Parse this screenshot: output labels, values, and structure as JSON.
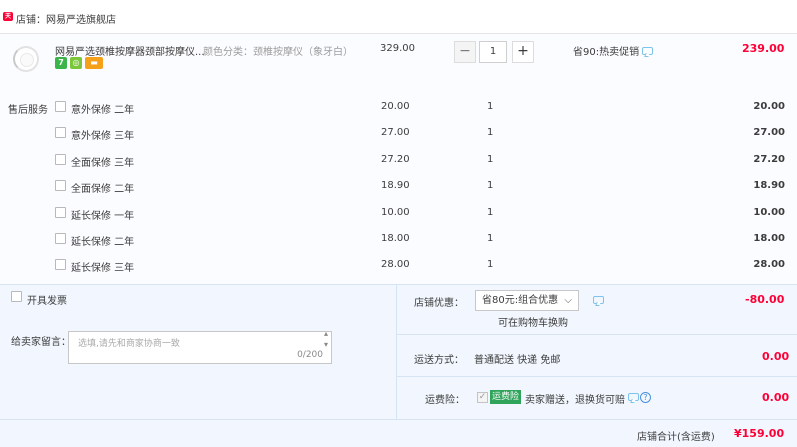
{
  "shop": {
    "badge": "天猫",
    "label": "店铺：网易严选旗舰店"
  },
  "item": {
    "title": "网易严选颈椎按摩器颈部按摩仪...",
    "sku": "颜色分类：颈椎按摩仪（象牙白）",
    "icons": [
      "seven-day-return-icon",
      "green-bag-icon",
      "card-icon"
    ],
    "price": "329.00",
    "quantity": "1",
    "minus": "−",
    "plus": "+",
    "promo": "省90:热卖促销",
    "subtotal": "239.00"
  },
  "services": {
    "label": "售后服务",
    "rows": [
      {
        "name": "意外保修 二年",
        "price": "20.00",
        "qty": "1",
        "sum": "20.00"
      },
      {
        "name": "意外保修 三年",
        "price": "27.00",
        "qty": "1",
        "sum": "27.00"
      },
      {
        "name": "全面保修 三年",
        "price": "27.20",
        "qty": "1",
        "sum": "27.20"
      },
      {
        "name": "全面保修 二年",
        "price": "18.90",
        "qty": "1",
        "sum": "18.90"
      },
      {
        "name": "延长保修 一年",
        "price": "10.00",
        "qty": "1",
        "sum": "10.00"
      },
      {
        "name": "延长保修 二年",
        "price": "18.00",
        "qty": "1",
        "sum": "18.00"
      },
      {
        "name": "延长保修 三年",
        "price": "28.00",
        "qty": "1",
        "sum": "28.00"
      }
    ]
  },
  "invoice": {
    "label": "开具发票"
  },
  "message": {
    "label": "给卖家留言：",
    "placeholder": "选填,请先和商家协商一致",
    "count": "0/200"
  },
  "discount": {
    "label": "店铺优惠：",
    "selected": "省80元:组合优惠",
    "note": "可在购物车换购",
    "value": "-80.00"
  },
  "shipping": {
    "label": "运送方式：",
    "value": "普通配送 快递 免邮",
    "amount": "0.00"
  },
  "insurance": {
    "label": "运费险：",
    "tag": "运费险",
    "text": "卖家赠送，退换货可赔",
    "amount": "0.00"
  },
  "total": {
    "label": "店铺合计(含运费)",
    "value": "¥159.00"
  },
  "colors": {
    "accent": "#ff0036",
    "panel": "#f2f7ff",
    "insurance_tag": "#2fa45a"
  }
}
